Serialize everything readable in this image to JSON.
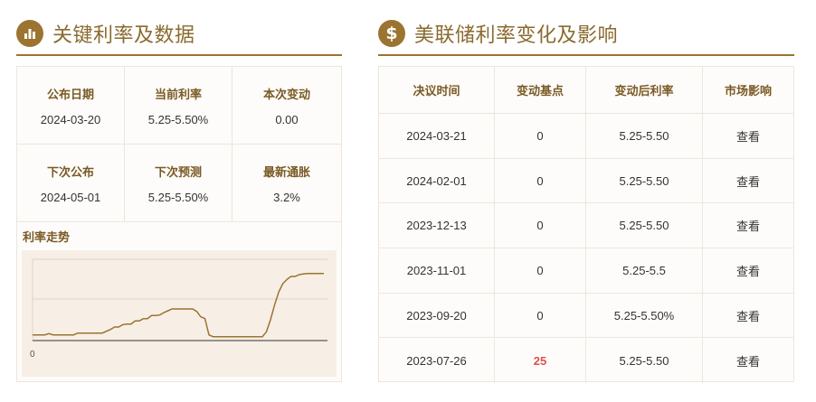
{
  "left_section": {
    "title": "关键利率及数据",
    "icon": "bar-chart-icon"
  },
  "right_section": {
    "title": "美联储利率变化及影响",
    "icon": "dollar-icon"
  },
  "stats": [
    {
      "label": "公布日期",
      "value": "2024-03-20"
    },
    {
      "label": "当前利率",
      "value": "5.25-5.50%"
    },
    {
      "label": "本次变动",
      "value": "0.00"
    },
    {
      "label": "下次公布",
      "value": "2024-05-01"
    },
    {
      "label": "下次预测",
      "value": "5.25-5.50%"
    },
    {
      "label": "最新通胀",
      "value": "3.2%"
    }
  ],
  "trend": {
    "label": "利率走势",
    "chart_data": {
      "type": "line",
      "y_tick_label": "0",
      "values": [
        0.25,
        0.25,
        0.25,
        0.25,
        0.35,
        0.25,
        0.25,
        0.25,
        0.25,
        0.25,
        0.25,
        0.4,
        0.4,
        0.4,
        0.4,
        0.4,
        0.4,
        0.4,
        0.55,
        0.7,
        0.9,
        0.9,
        1.1,
        1.15,
        1.15,
        1.4,
        1.4,
        1.6,
        1.6,
        1.85,
        1.85,
        1.9,
        2.1,
        2.25,
        2.4,
        2.4,
        2.4,
        2.4,
        2.4,
        2.4,
        2.2,
        1.75,
        1.6,
        0.25,
        0.1,
        0.1,
        0.1,
        0.1,
        0.1,
        0.1,
        0.1,
        0.1,
        0.1,
        0.1,
        0.1,
        0.1,
        0.1,
        0.5,
        1.5,
        2.75,
        3.8,
        4.5,
        4.85,
        5.1,
        5.1,
        5.25,
        5.3,
        5.35,
        5.35,
        5.35,
        5.35,
        5.35
      ]
    }
  },
  "table": {
    "headers": [
      "决议时间",
      "变动基点",
      "变动后利率",
      "市场影响"
    ],
    "rows": [
      {
        "date": "2024-03-21",
        "bp": "0",
        "rate": "5.25-5.50",
        "impact": "查看",
        "highlight": false
      },
      {
        "date": "2024-02-01",
        "bp": "0",
        "rate": "5.25-5.50",
        "impact": "查看",
        "highlight": false
      },
      {
        "date": "2023-12-13",
        "bp": "0",
        "rate": "5.25-5.50",
        "impact": "查看",
        "highlight": false
      },
      {
        "date": "2023-11-01",
        "bp": "0",
        "rate": "5.25-5.5",
        "impact": "查看",
        "highlight": false
      },
      {
        "date": "2023-09-20",
        "bp": "0",
        "rate": "5.25-5.50%",
        "impact": "查看",
        "highlight": false
      },
      {
        "date": "2023-07-26",
        "bp": "25",
        "rate": "5.25-5.50",
        "impact": "查看",
        "highlight": true
      }
    ]
  },
  "colors": {
    "accent": "#9a7430",
    "heading": "#7a5a25",
    "chart_line": "#9a7430",
    "highlight": "#d9534f",
    "chart_bg": "#f7efe6"
  }
}
